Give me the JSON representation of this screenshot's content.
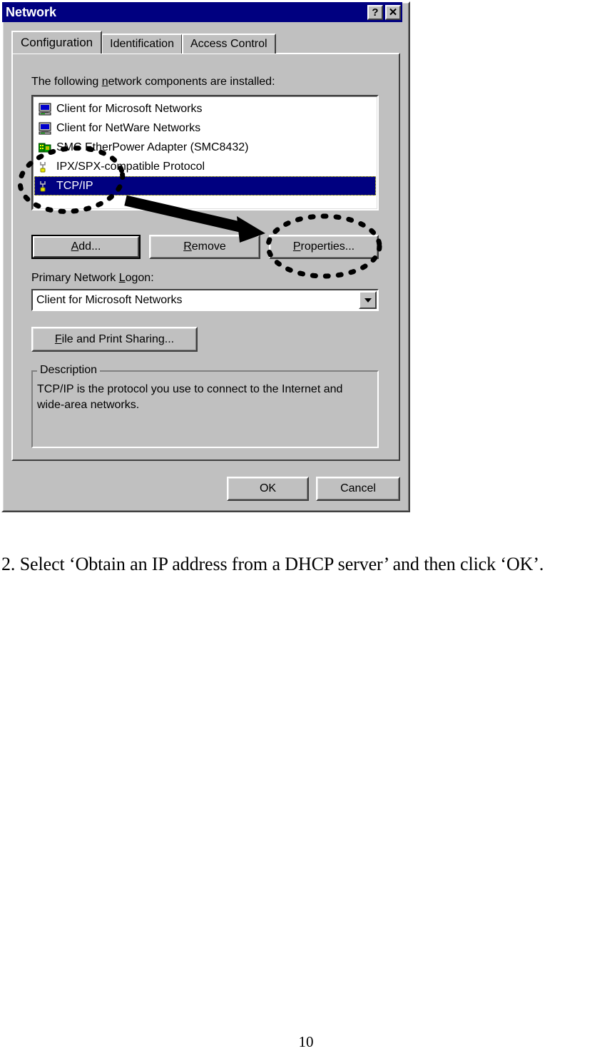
{
  "dialog": {
    "title": "Network",
    "title_buttons": [
      {
        "name": "help-button",
        "glyph": "?"
      },
      {
        "name": "close-button",
        "glyph": "✕"
      }
    ],
    "tabs": [
      {
        "label": "Configuration",
        "active": true
      },
      {
        "label": "Identification",
        "active": false
      },
      {
        "label": "Access Control",
        "active": false
      }
    ],
    "components_label_pre": "The following ",
    "components_label_accel": "n",
    "components_label_post": "etwork components are installed:",
    "components": [
      {
        "label": "Client for Microsoft Networks",
        "icon": "computer-icon",
        "selected": false
      },
      {
        "label": "Client for NetWare Networks",
        "icon": "computer-icon",
        "selected": false
      },
      {
        "label": "SMC EtherPower Adapter (SMC8432)",
        "icon": "network-adapter-icon",
        "selected": false
      },
      {
        "label": "IPX/SPX-compatible Protocol",
        "icon": "protocol-icon",
        "selected": false
      },
      {
        "label": "TCP/IP",
        "icon": "protocol-icon",
        "selected": true
      }
    ],
    "buttons": {
      "add": {
        "accel": "A",
        "rest": "dd...",
        "full": "Add..."
      },
      "remove": {
        "accel": "R",
        "rest": "emove",
        "full": "Remove"
      },
      "properties": {
        "accel": "P",
        "rest": "roperties...",
        "full": "Properties..."
      },
      "file_print_sharing": {
        "accel": "F",
        "rest": "ile and Print Sharing...",
        "full": "File and Print Sharing..."
      },
      "ok": "OK",
      "cancel": "Cancel"
    },
    "primary_logon": {
      "label_pre": "Primary Network ",
      "label_accel": "L",
      "label_post": "ogon:",
      "full_label": "Primary Network Logon:",
      "value": "Client for Microsoft Networks"
    },
    "description": {
      "legend": "Description",
      "text": "TCP/IP is the protocol you use to connect to the Internet and wide-area networks."
    }
  },
  "annotations": {
    "ellipse_selected_item": "highlight-ellipse-tcpip",
    "ellipse_properties": "highlight-ellipse-properties",
    "arrow": "pointer-arrow"
  },
  "page": {
    "caption": "2. Select ‘Obtain an IP address from a DHCP server’ and then click ‘OK’.",
    "number": "10"
  },
  "colors": {
    "titlebar": "#000080",
    "face": "#c0c0c0",
    "selection": "#000080",
    "window": "#ffffff"
  }
}
